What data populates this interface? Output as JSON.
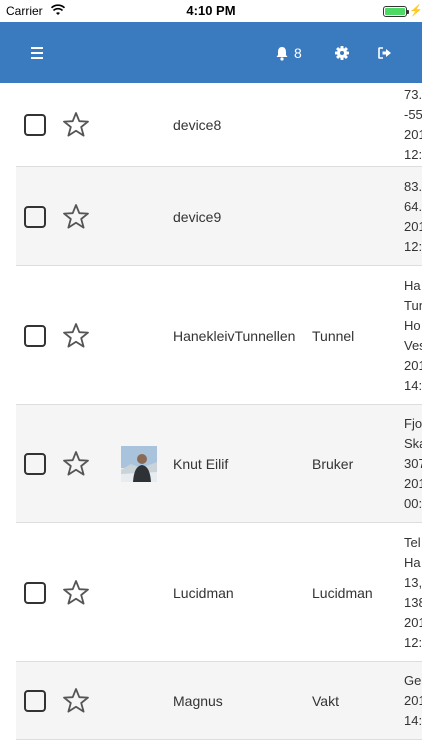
{
  "status_bar": {
    "carrier": "Carrier",
    "time": "4:10 PM"
  },
  "navbar": {
    "color": "#3a7bc0",
    "notification_count": "8"
  },
  "rows": [
    {
      "name": "device8",
      "type": "",
      "info": [
        "73.",
        "-55",
        "201",
        "12:"
      ]
    },
    {
      "name": "device9",
      "type": "",
      "info": [
        "83.",
        "64.",
        "201",
        "12:"
      ]
    },
    {
      "name": "HanekleivTunnellen",
      "type": "Tunnel",
      "info": [
        "Ha",
        "Tun",
        "Ho",
        "Ves",
        "201",
        "14:"
      ]
    },
    {
      "name": "Knut Eilif",
      "type": "Bruker",
      "info": [
        "Fjo",
        "Ska",
        "307",
        "201",
        "00:"
      ],
      "avatar": true
    },
    {
      "name": "Lucidman",
      "type": "Lucidman",
      "info": [
        "Tel",
        "Ha",
        "13,",
        "138",
        "201",
        "12:"
      ]
    },
    {
      "name": "Magnus",
      "type": "Vakt",
      "info": [
        "Ge",
        "201",
        "14:"
      ]
    }
  ]
}
